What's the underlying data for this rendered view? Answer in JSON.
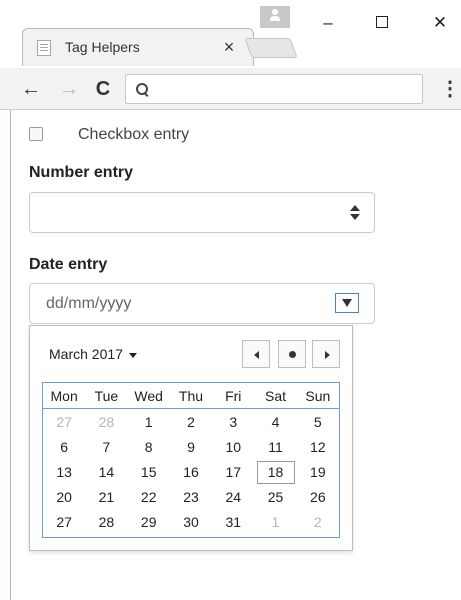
{
  "tab": {
    "title": "Tag Helpers",
    "close": "×"
  },
  "window": {
    "minimize": "–",
    "close": "✕"
  },
  "toolbar": {
    "back": "←",
    "forward": "→",
    "reload": "C",
    "menu": "⋮",
    "omnibox_value": ""
  },
  "form": {
    "checkbox_label": "Checkbox entry",
    "checkbox_checked": false,
    "number_label": "Number entry",
    "number_value": "",
    "date_label": "Date entry",
    "date_placeholder": "dd/mm/yyyy"
  },
  "calendar": {
    "month_label": "March 2017",
    "weekdays": [
      "Mon",
      "Tue",
      "Wed",
      "Thu",
      "Fri",
      "Sat",
      "Sun"
    ],
    "weeks": [
      [
        {
          "d": "27",
          "muted": true
        },
        {
          "d": "28",
          "muted": true
        },
        {
          "d": "1"
        },
        {
          "d": "2"
        },
        {
          "d": "3"
        },
        {
          "d": "4"
        },
        {
          "d": "5"
        }
      ],
      [
        {
          "d": "6"
        },
        {
          "d": "7"
        },
        {
          "d": "8"
        },
        {
          "d": "9"
        },
        {
          "d": "10"
        },
        {
          "d": "11"
        },
        {
          "d": "12"
        }
      ],
      [
        {
          "d": "13"
        },
        {
          "d": "14"
        },
        {
          "d": "15"
        },
        {
          "d": "16"
        },
        {
          "d": "17"
        },
        {
          "d": "18",
          "today": true
        },
        {
          "d": "19"
        }
      ],
      [
        {
          "d": "20"
        },
        {
          "d": "21"
        },
        {
          "d": "22"
        },
        {
          "d": "23"
        },
        {
          "d": "24"
        },
        {
          "d": "25"
        },
        {
          "d": "26"
        }
      ],
      [
        {
          "d": "27"
        },
        {
          "d": "28"
        },
        {
          "d": "29"
        },
        {
          "d": "30"
        },
        {
          "d": "31"
        },
        {
          "d": "1",
          "muted": true
        },
        {
          "d": "2",
          "muted": true
        }
      ]
    ]
  }
}
